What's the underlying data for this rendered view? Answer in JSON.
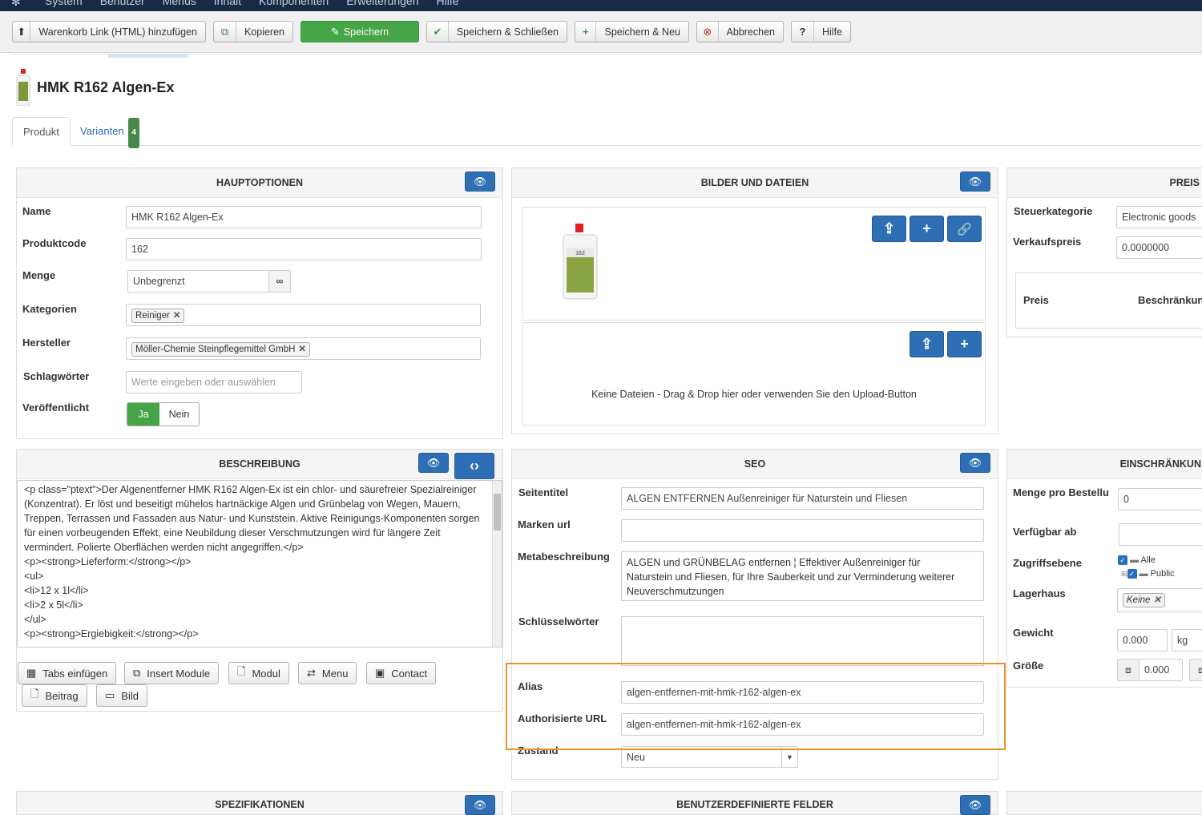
{
  "topnav": {
    "items": [
      "System",
      "Benutzer",
      "Menüs",
      "Inhalt",
      "Komponenten",
      "Erweiterungen",
      "Hilfe"
    ]
  },
  "toolbar": {
    "cart_link": "Warenkorb Link (HTML) hinzufügen",
    "copy": "Kopieren",
    "save": "Speichern",
    "save_close": "Speichern & Schließen",
    "save_new": "Speichern & Neu",
    "cancel": "Abbrechen",
    "help": "Hilfe"
  },
  "product": {
    "title": "HMK R162 Algen-Ex"
  },
  "tabs": {
    "product": "Produkt",
    "variants": "Varianten",
    "variants_count": "4"
  },
  "hauptoptionen": {
    "header": "HAUPTOPTIONEN",
    "name_label": "Name",
    "name_value": "HMK R162 Algen-Ex",
    "code_label": "Produktcode",
    "code_value": "162",
    "qty_label": "Menge",
    "qty_value": "Unbegrenzt",
    "cat_label": "Kategorien",
    "cat_chip": "Reiniger",
    "mfr_label": "Hersteller",
    "mfr_chip": "Möller-Chemie Steinpflegemittel GmbH",
    "tags_label": "Schlagwörter",
    "tags_placeholder": "Werte eingeben oder auswählen",
    "pub_label": "Veröffentlicht",
    "pub_yes": "Ja",
    "pub_no": "Nein"
  },
  "bilder": {
    "header": "BILDER UND DATEIEN",
    "no_files": "Keine Dateien - Drag & Drop hier oder verwenden Sie den Upload-Button"
  },
  "preis": {
    "header": "PREIS",
    "tax_label": "Steuerkategorie",
    "tax_value": "Electronic goods",
    "price_label": "Verkaufspreis",
    "price_value": "0.0000000",
    "col_price": "Preis",
    "col_restrict": "Beschränkun"
  },
  "beschreibung": {
    "header": "BESCHREIBUNG",
    "lines": [
      "<p class=\"ptext\">Der Algenentferner HMK R162 Algen-Ex ist ein chlor- und säurefreier Spezialreiniger",
      "(Konzentrat). Er löst und beseitigt mühelos hartnäckige Algen und Grünbelag von Wegen, Mauern,",
      "Treppen, Terrassen und Fassaden aus Natur- und Kunststein. Aktive Reinigungs-Komponenten sorgen",
      "für einen vorbeugenden Effekt, eine Neubildung dieser Verschmutzungen wird für längere Zeit",
      "vermindert. Polierte Oberflächen werden nicht angegriffen.</p>",
      "<p><strong>Lieferform:</strong></p>",
      "<ul>",
      "<li>12 x 1l</li>",
      "<li>2 x 5l</li>",
      "</ul>",
      "<p><strong>Ergiebigkeit:</strong></p>"
    ],
    "btn_tabs": "Tabs einfügen",
    "btn_module": "Insert Module",
    "btn_modul": "Modul",
    "btn_menu": "Menu",
    "btn_contact": "Contact",
    "btn_article": "Beitrag",
    "btn_image": "Bild"
  },
  "seo": {
    "header": "SEO",
    "pagetitle_label": "Seitentitel",
    "pagetitle_value": "ALGEN ENTFERNEN Außenreiniger für Naturstein und Fliesen",
    "brandurl_label": "Marken url",
    "brandurl_value": "",
    "metadesc_label": "Metabeschreibung",
    "metadesc_value": "ALGEN und GRÜNBELAG entfernen ¦ Effektiver Außenreiniger für Naturstein und Fliesen, für Ihre Sauberkeit und zur Verminderung weiterer Neuverschmutzungen",
    "keywords_label": "Schlüsselwörter",
    "alias_label": "Alias",
    "alias_value": "algen-entfernen-mit-hmk-r162-algen-ex",
    "authurl_label": "Authorisierte URL",
    "authurl_value": "algen-entfernen-mit-hmk-r162-algen-ex",
    "state_label": "Zustand",
    "state_value": "Neu"
  },
  "einschraenkungen": {
    "header": "EINSCHRÄNKUN",
    "minqty_label": "Menge pro Bestellu",
    "minqty_value": "0",
    "avail_label": "Verfügbar ab",
    "access_label": "Zugriffsebene",
    "access_all": "Alle",
    "access_public": "Public",
    "warehouse_label": "Lagerhaus",
    "warehouse_chip": "Keine",
    "weight_label": "Gewicht",
    "weight_value": "0.000",
    "weight_unit": "kg",
    "size_label": "Größe",
    "size_value": "0.000"
  },
  "bottom": {
    "spec": "SPEZIFIKATIONEN",
    "custom": "BENUTZERDEFINIERTE FELDER"
  }
}
